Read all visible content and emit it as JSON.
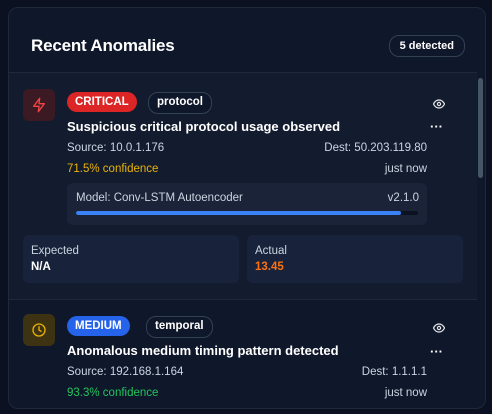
{
  "header": {
    "title": "Recent Anomalies",
    "count_badge": "5 detected"
  },
  "anomalies": [
    {
      "severity": "CRITICAL",
      "category": "protocol",
      "icon": "lightning-icon",
      "title": "Suspicious critical protocol usage observed",
      "source": "Source: 10.0.1.176",
      "dest": "Dest: 50.203.119.80",
      "confidence": "71.5% confidence",
      "time": "just now",
      "model": {
        "name": "Model: Conv-LSTM Autoencoder",
        "version": "v2.1.0",
        "progress": 0.95
      },
      "expected_label": "Expected",
      "expected_value": "N/A",
      "actual_label": "Actual",
      "actual_value": "13.45"
    },
    {
      "severity": "MEDIUM",
      "category": "temporal",
      "icon": "clock-icon",
      "title": "Anomalous medium timing pattern detected",
      "source": "Source: 192.168.1.164",
      "dest": "Dest: 1.1.1.1",
      "confidence": "93.3% confidence",
      "time": "just now"
    }
  ],
  "colors": {
    "critical": "#dc2626",
    "medium": "#2563eb",
    "confidence_warn": "#eab308",
    "confidence_ok": "#22c55e",
    "actual": "#f97316",
    "model_bar": "#3b82f6"
  }
}
